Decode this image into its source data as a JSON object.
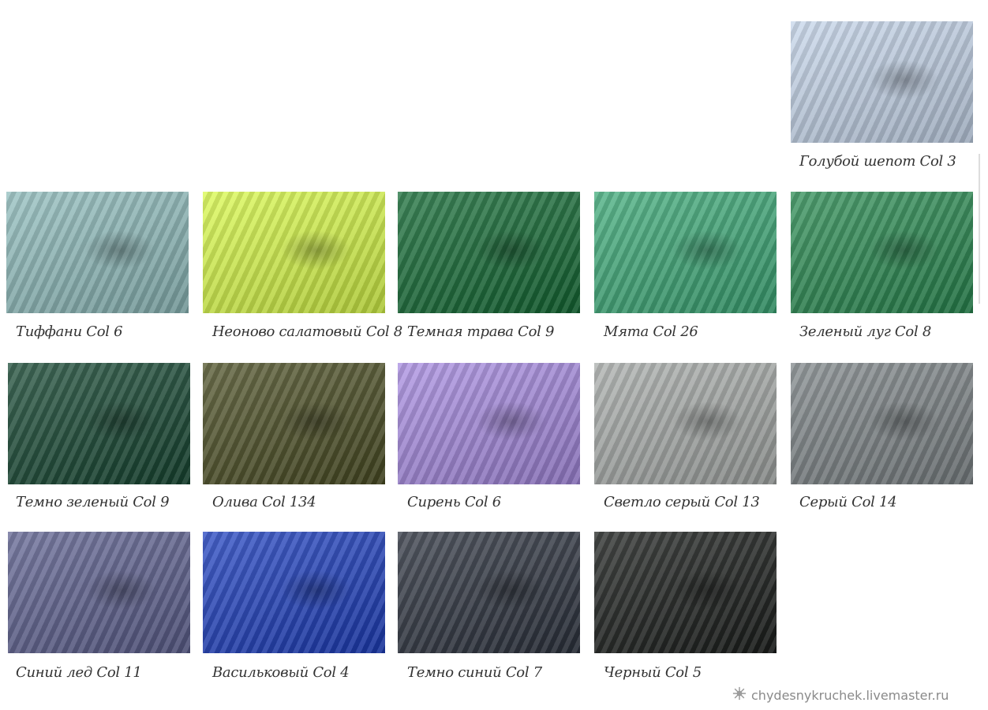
{
  "swatches": [
    {
      "id": "sw-0",
      "label": "Голубой шепот Col 3",
      "color": "#c5d5ea"
    },
    {
      "id": "sw-1",
      "label": "Тиффани Col 6",
      "color": "#8fbcbc"
    },
    {
      "id": "sw-2",
      "label": "Неоново салатовый Col 8",
      "color": "#d8f948"
    },
    {
      "id": "sw-3",
      "label": "Темная трава Col 9",
      "color": "#146b35"
    },
    {
      "id": "sw-4",
      "label": "Мята Col 26",
      "color": "#3daa78"
    },
    {
      "id": "sw-5",
      "label": "Зеленый луг Col 8",
      "color": "#2a8b52"
    },
    {
      "id": "sw-6",
      "label": "Темно зеленый Col 9",
      "color": "#174833"
    },
    {
      "id": "sw-7",
      "label": "Олива Col 134",
      "color": "#4c4f25"
    },
    {
      "id": "sw-8",
      "label": "Сирень Col 6",
      "color": "#a68ae0"
    },
    {
      "id": "sw-9",
      "label": "Светло серый Col 13",
      "color": "#a8acaa"
    },
    {
      "id": "sw-10",
      "label": "Серый Col 14",
      "color": "#7e8588"
    },
    {
      "id": "sw-11",
      "label": "Синий лед Col 11",
      "color": "#5e6190"
    },
    {
      "id": "sw-12",
      "label": "Васильковый Col 4",
      "color": "#1e3fbf"
    },
    {
      "id": "sw-13",
      "label": "Темно синий Col 7",
      "color": "#2e3440"
    },
    {
      "id": "sw-14",
      "label": "Черный Col 5",
      "color": "#1c1f1d"
    }
  ],
  "watermark": {
    "text": "chydesnykruchek.livemaster.ru",
    "icon": "snowflake-icon"
  }
}
